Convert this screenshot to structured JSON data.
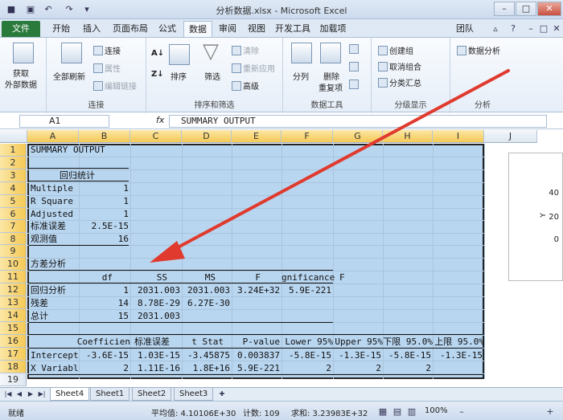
{
  "window": {
    "title": "分析数据.xlsx - Microsoft Excel"
  },
  "tabs": [
    "文件",
    "开始",
    "插入",
    "页面布局",
    "公式",
    "数据",
    "审阅",
    "视图",
    "开发工具",
    "加载项",
    "团队"
  ],
  "ribbon": {
    "get_data": {
      "label1": "获取",
      "label2": "外部数据"
    },
    "connections": {
      "refresh": "全部刷新",
      "connections": "连接",
      "properties": "属性",
      "edit_links": "编辑链接",
      "group": "连接"
    },
    "sort": {
      "sort": "排序",
      "filter": "筛选",
      "clear": "清除",
      "reapply": "重新应用",
      "advanced": "高级",
      "group": "排序和筛选"
    },
    "tools": {
      "split": "分列",
      "remove_dup1": "删除",
      "remove_dup2": "重复项",
      "group": "数据工具"
    },
    "outline": {
      "group_btn": "创建组",
      "ungroup": "取消组合",
      "subtotal": "分类汇总",
      "group": "分级显示"
    },
    "analysis": {
      "btn": "数据分析",
      "group": "分析"
    }
  },
  "formula_bar": {
    "name_box": "A1",
    "fx": "fx",
    "formula": "SUMMARY OUTPUT"
  },
  "columns": [
    "A",
    "B",
    "C",
    "D",
    "E",
    "F",
    "G",
    "H",
    "I",
    "J"
  ],
  "rows": [
    "1",
    "2",
    "3",
    "4",
    "5",
    "6",
    "7",
    "8",
    "9",
    "10",
    "11",
    "12",
    "13",
    "14",
    "15",
    "16",
    "17",
    "18",
    "19"
  ],
  "cells": {
    "r1": "SUMMARY OUTPUT",
    "r3": "回归统计",
    "r4": [
      "Multiple",
      "1"
    ],
    "r5": [
      "R Square",
      "1"
    ],
    "r6": [
      "Adjusted",
      "1"
    ],
    "r7": [
      "标准误差",
      "2.5E-15"
    ],
    "r8": [
      "观测值",
      "16"
    ],
    "r10": "方差分析",
    "r11": [
      "df",
      "SS",
      "MS",
      "F",
      "gnificance",
      "F"
    ],
    "r12": [
      "回归分析",
      "1",
      "2031.003",
      "2031.003",
      "3.24E+32",
      "5.9E-221"
    ],
    "r13": [
      "残差",
      "14",
      "8.78E-29",
      "6.27E-30"
    ],
    "r14": [
      "总计",
      "15",
      "2031.003"
    ],
    "r16": [
      "Coefficien",
      "标准误差",
      "t Stat",
      "P-value",
      "Lower 95%",
      "Upper 95%",
      "下限 95.0%",
      "上限 95.0%"
    ],
    "r17": [
      "Intercept",
      "-3.6E-15",
      "1.03E-15",
      "-3.45875",
      "0.003837",
      "-5.8E-15",
      "-1.3E-15",
      "-5.8E-15",
      "-1.3E-15"
    ],
    "r18": [
      "X Variabl",
      "2",
      "1.11E-16",
      "1.8E+16",
      "5.9E-221",
      "2",
      "2",
      "2"
    ]
  },
  "chart": {
    "yticks": [
      "40",
      "20",
      "0"
    ],
    "ylabel": "Y"
  },
  "sheets": [
    "Sheet4",
    "Sheet1",
    "Sheet2",
    "Sheet3"
  ],
  "status": {
    "ready": "就绪",
    "average": "平均值: 4.10106E+30",
    "count": "计数: 109",
    "sum": "求和: 3.23983E+32",
    "zoom": "100%"
  },
  "colors": {
    "selection": "#b9d6f0",
    "file_tab": "#2a7a3c",
    "arrow": "#e03a2e"
  }
}
